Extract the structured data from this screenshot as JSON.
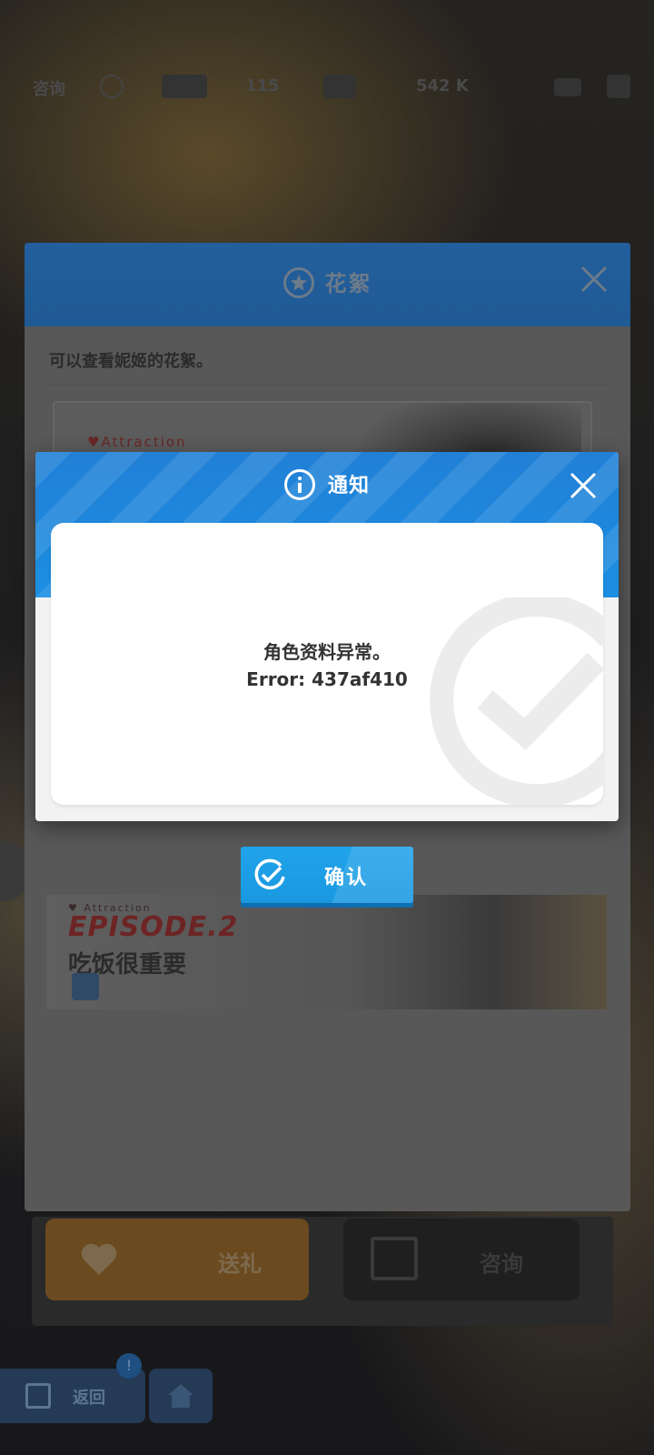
{
  "topbar": {
    "consult_label": "咨询",
    "level": "115",
    "currency": "542 K"
  },
  "panel": {
    "title": "花絮",
    "description": "可以查看妮姬的花絮。",
    "card1_tag": "♥Attraction",
    "card2_tag": "♥ Attraction",
    "card2_episode": "EPISODE.2",
    "card2_title": "吃饭很重要"
  },
  "bottom": {
    "gift_label": "送礼",
    "consult_label": "咨询",
    "back_label": "返回",
    "badge": "!"
  },
  "dialog": {
    "title": "通知",
    "message": "角色资料异常。",
    "error": "Error: 437af410",
    "confirm_label": "确认"
  },
  "colors": {
    "header_blue": "#1b8ee2",
    "confirm_blue": "#1998e0",
    "text_dark": "#333333"
  }
}
